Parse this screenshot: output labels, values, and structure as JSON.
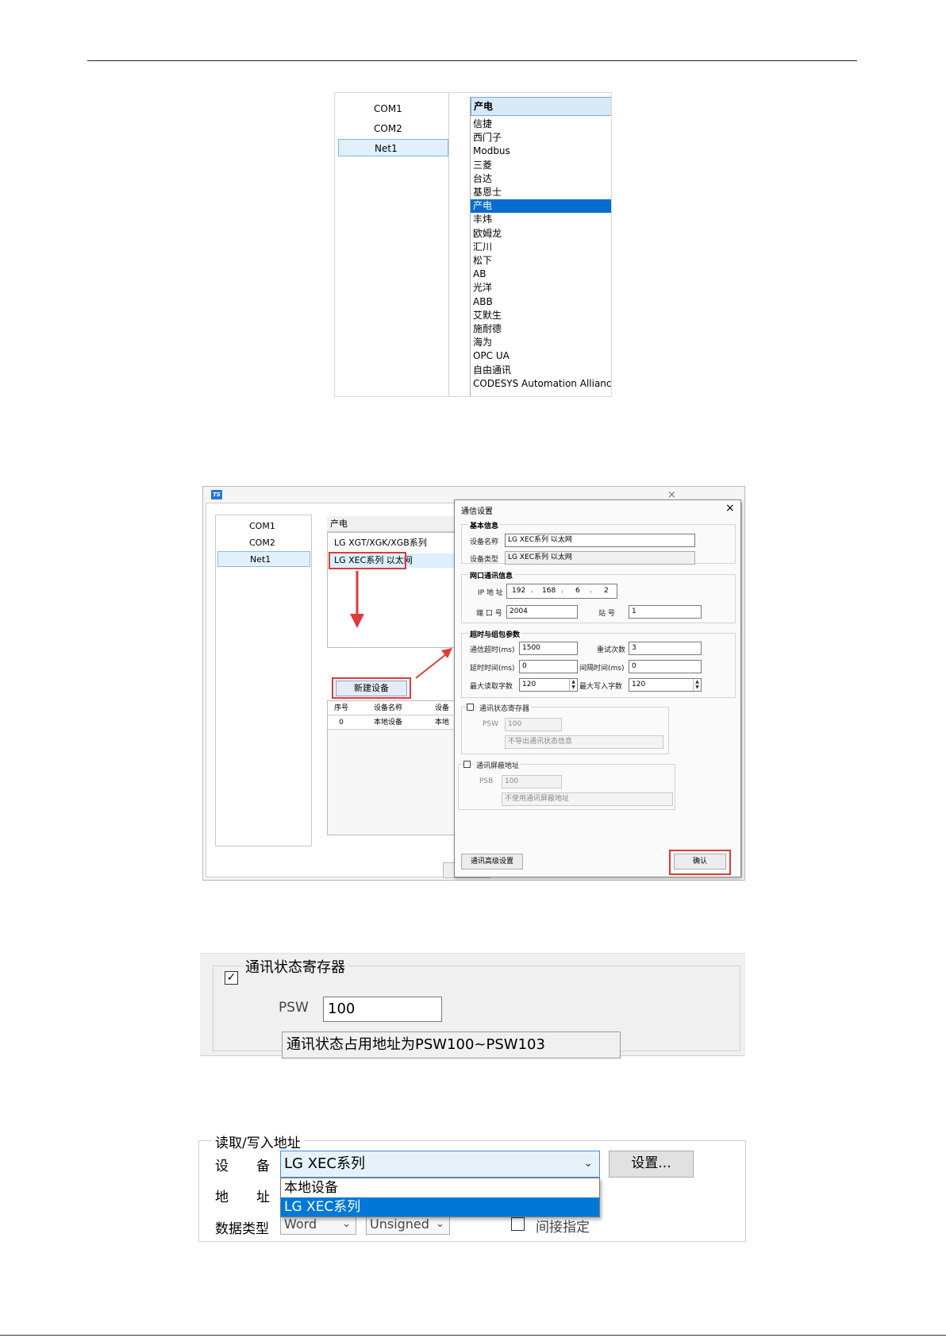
{
  "fig1": {
    "ports": [
      "COM1",
      "COM2",
      "Net1"
    ],
    "selected_port": "Net1",
    "brand_header": "产电",
    "brands": [
      "信捷",
      "西门子",
      "Modbus",
      "三菱",
      "台达",
      "基恩士",
      "产电",
      "丰炜",
      "欧姆龙",
      "汇川",
      "松下",
      "AB",
      "光洋",
      "ABB",
      "艾默生",
      "施耐德",
      "海为",
      "OPC UA",
      "自由通讯",
      "CODESYS Automation Alliance"
    ],
    "selected_brand": "产电"
  },
  "fig2": {
    "app_logo": "TS",
    "bg_close": "×",
    "ports": [
      "COM1",
      "COM2",
      "Net1"
    ],
    "brand_header": "产电",
    "series": [
      "LG XGT/XGK/XGB系列",
      "LG XEC系列 以太网"
    ],
    "new_device_button": "新建设备",
    "table_headers": [
      "序号",
      "设备名称",
      "设备"
    ],
    "table_row": [
      "0",
      "本地设备",
      "本地"
    ],
    "dialog": {
      "title": "通信设置",
      "close": "×",
      "basic": {
        "title": "基本信息",
        "name_label": "设备名称",
        "name_value": "LG XEC系列 以太网",
        "type_label": "设备类型",
        "type_value": "LG XEC系列 以太网"
      },
      "net": {
        "title": "网口通讯信息",
        "ip_label": "IP 地 址",
        "ip": [
          "192",
          "168",
          "6",
          "2"
        ],
        "ip_dot": ".",
        "port_label": "端 口 号",
        "port_value": "2004",
        "station_label": "站    号",
        "station_value": "1"
      },
      "timeout": {
        "title": "超时与组包参数",
        "comm_timeout_label": "通信超时(ms)",
        "comm_timeout_value": "1500",
        "retry_label": "重试次数",
        "retry_value": "3",
        "delay_label": "延时时间(ms)",
        "delay_value": "0",
        "interval_label": "间隔时间(ms)",
        "interval_value": "0",
        "max_read_label": "最大读取字数",
        "max_read_value": "120",
        "max_write_label": "最大写入字数",
        "max_write_value": "120"
      },
      "status_reg": {
        "title": "通讯状态寄存器",
        "label": "PSW",
        "value": "100",
        "note": "不导出通讯状态信息"
      },
      "shield": {
        "title": "通讯屏蔽地址",
        "label": "PSB",
        "value": "100",
        "note": "不使用通讯屏蔽地址"
      },
      "advanced_button": "通讯高级设置",
      "ok_button": "确认"
    }
  },
  "fig3": {
    "checkbox_mark": "✓",
    "title": "通讯状态寄存器",
    "label": "PSW",
    "value": "100",
    "note": "通讯状态占用地址为PSW100~PSW103"
  },
  "fig4": {
    "title": "读取/写入地址",
    "device_label_a": "设",
    "device_label_b": "备",
    "device_value": "LG XEC系列",
    "settings_button": "设置...",
    "address_label_a": "地",
    "address_label_b": "址",
    "dropdown_options": [
      "本地设备",
      "LG XEC系列"
    ],
    "datatype_label": "数据类型",
    "datatype_value": "Word",
    "sign_value": "Unsigned",
    "indirect_label": "间接指定"
  }
}
